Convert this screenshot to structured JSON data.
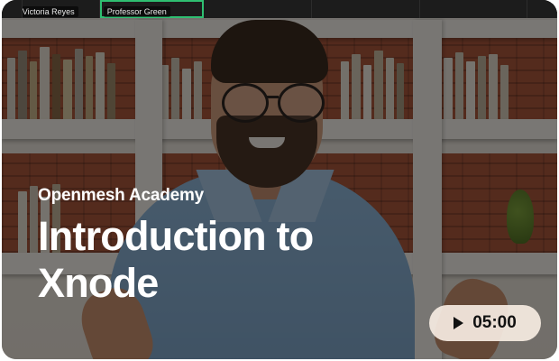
{
  "participants": [
    {
      "name": ""
    },
    {
      "name": "Victoria Reyes"
    },
    {
      "name": "Professor Green",
      "active": true
    },
    {
      "name": ""
    },
    {
      "name": ""
    },
    {
      "name": ""
    },
    {
      "name": ""
    }
  ],
  "course": {
    "organization": "Openmesh Academy",
    "title": "Introduction to Xnode"
  },
  "player": {
    "icon": "play-icon",
    "duration": "05:00"
  },
  "colors": {
    "overlay_text": "#ffffff",
    "pill_background": "#f6ece2",
    "pill_text": "#111111",
    "active_speaker_border": "#2fbf71"
  }
}
